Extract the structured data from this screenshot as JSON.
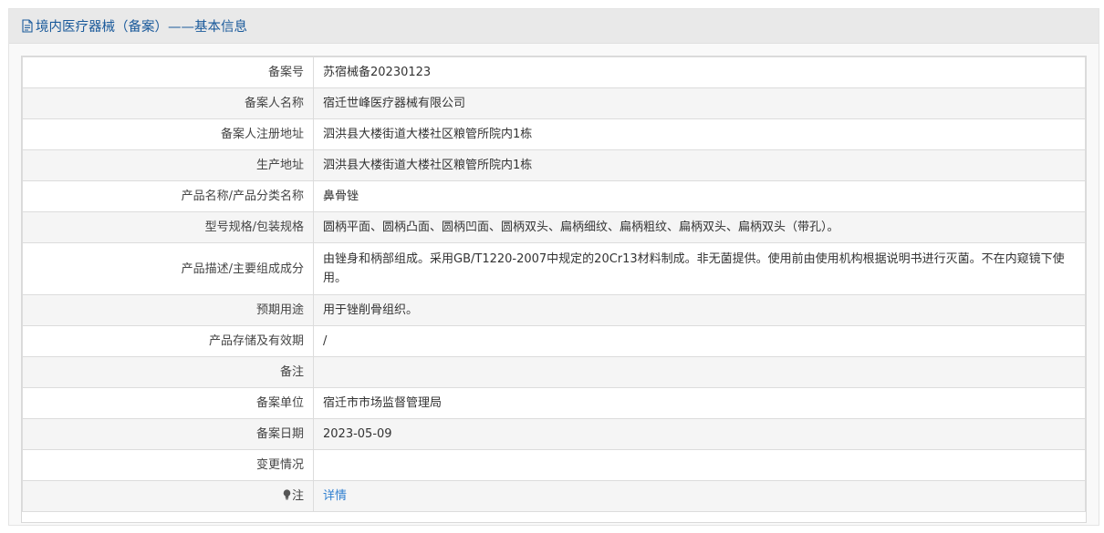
{
  "header": {
    "title": "境内医疗器械（备案）——基本信息",
    "icon": "document-icon"
  },
  "rows": [
    {
      "label": "备案号",
      "value": "苏宿械备20230123"
    },
    {
      "label": "备案人名称",
      "value": "宿迁世峰医疗器械有限公司"
    },
    {
      "label": "备案人注册地址",
      "value": "泗洪县大楼街道大楼社区粮管所院内1栋"
    },
    {
      "label": "生产地址",
      "value": "泗洪县大楼街道大楼社区粮管所院内1栋"
    },
    {
      "label": "产品名称/产品分类名称",
      "value": "鼻骨锉"
    },
    {
      "label": "型号规格/包装规格",
      "value": "圆柄平面、圆柄凸面、圆柄凹面、圆柄双头、扁柄细纹、扁柄粗纹、扁柄双头、扁柄双头（带孔）。"
    },
    {
      "label": "产品描述/主要组成成分",
      "value": "由锉身和柄部组成。采用GB/T1220-2007中规定的20Cr13材料制成。非无菌提供。使用前由使用机构根据说明书进行灭菌。不在内窥镜下使用。"
    },
    {
      "label": "预期用途",
      "value": "用于锉削骨组织。"
    },
    {
      "label": "产品存储及有效期",
      "value": "/"
    },
    {
      "label": "备注",
      "value": ""
    },
    {
      "label": "备案单位",
      "value": "宿迁市市场监督管理局"
    },
    {
      "label": "备案日期",
      "value": "2023-05-09"
    },
    {
      "label": "变更情况",
      "value": ""
    }
  ],
  "note_row": {
    "label": "注",
    "icon": "lightbulb-icon",
    "link_text": "详情"
  },
  "colors": {
    "title": "#1a5a9b",
    "link": "#2f7fd0",
    "header_bg": "#e9e9e9",
    "row_alt_bg": "#f5f5f5"
  }
}
